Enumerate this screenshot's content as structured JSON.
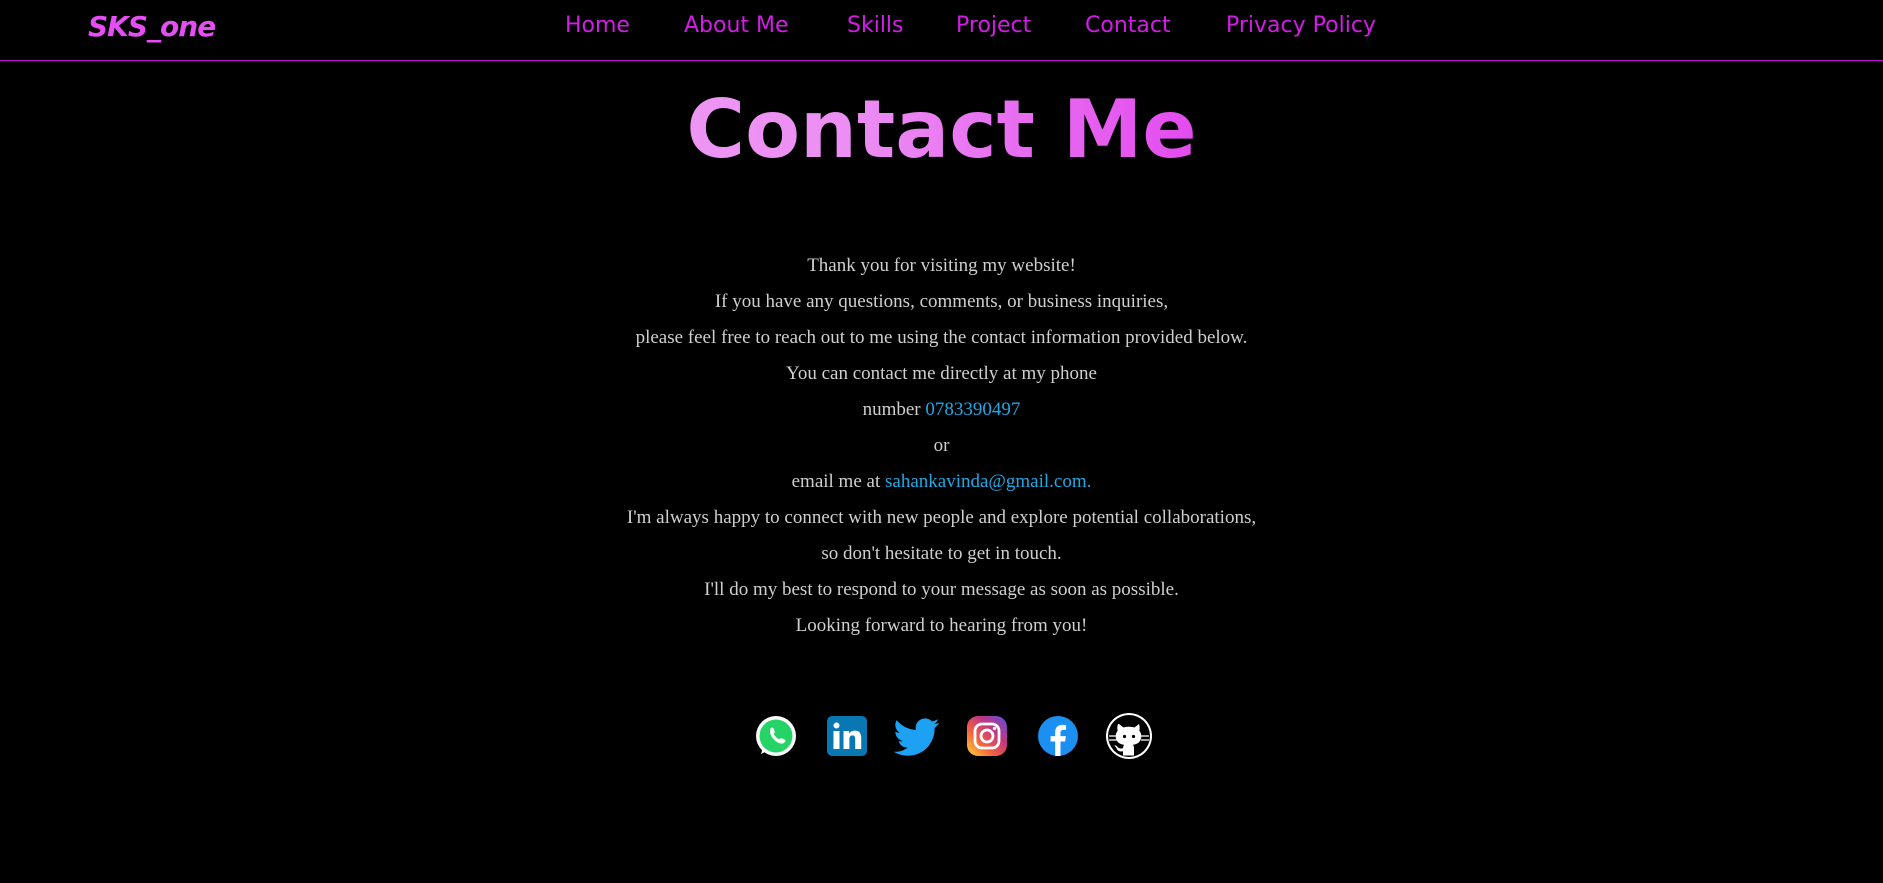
{
  "brand": {
    "logo_text": "SKS_one"
  },
  "nav": {
    "items": [
      {
        "label": "Home"
      },
      {
        "label": "About Me"
      },
      {
        "label": "Skills"
      },
      {
        "label": "Project"
      },
      {
        "label": "Contact"
      },
      {
        "label": "Privacy Policy"
      }
    ]
  },
  "page": {
    "title": "Contact Me"
  },
  "content": {
    "line1": "Thank you for visiting my website!",
    "line2": "If you have any questions, comments, or business inquiries,",
    "line3": "please feel free to reach out to me using the contact information provided below.",
    "line4": "You can contact me directly at my phone",
    "line5_prefix": "number ",
    "phone": "0783390497",
    "line6": "or",
    "line7_prefix": "email me at ",
    "email": "sahankavinda@gmail.com.",
    "line8": "I'm always happy to connect with new people and explore potential collaborations,",
    "line9": "so don't hesitate to get in touch.",
    "line10": "I'll do my best to respond to your message as soon as possible.",
    "line11": "Looking forward to hearing from you!"
  },
  "socials": [
    {
      "icon": "whatsapp-icon"
    },
    {
      "icon": "linkedin-icon"
    },
    {
      "icon": "twitter-icon"
    },
    {
      "icon": "instagram-icon"
    },
    {
      "icon": "facebook-icon"
    },
    {
      "icon": "github-icon"
    }
  ],
  "colors": {
    "background": "#000000",
    "accent": "#d31ce6",
    "link": "#1ea9e6",
    "body_text": "#cfcfcf"
  }
}
